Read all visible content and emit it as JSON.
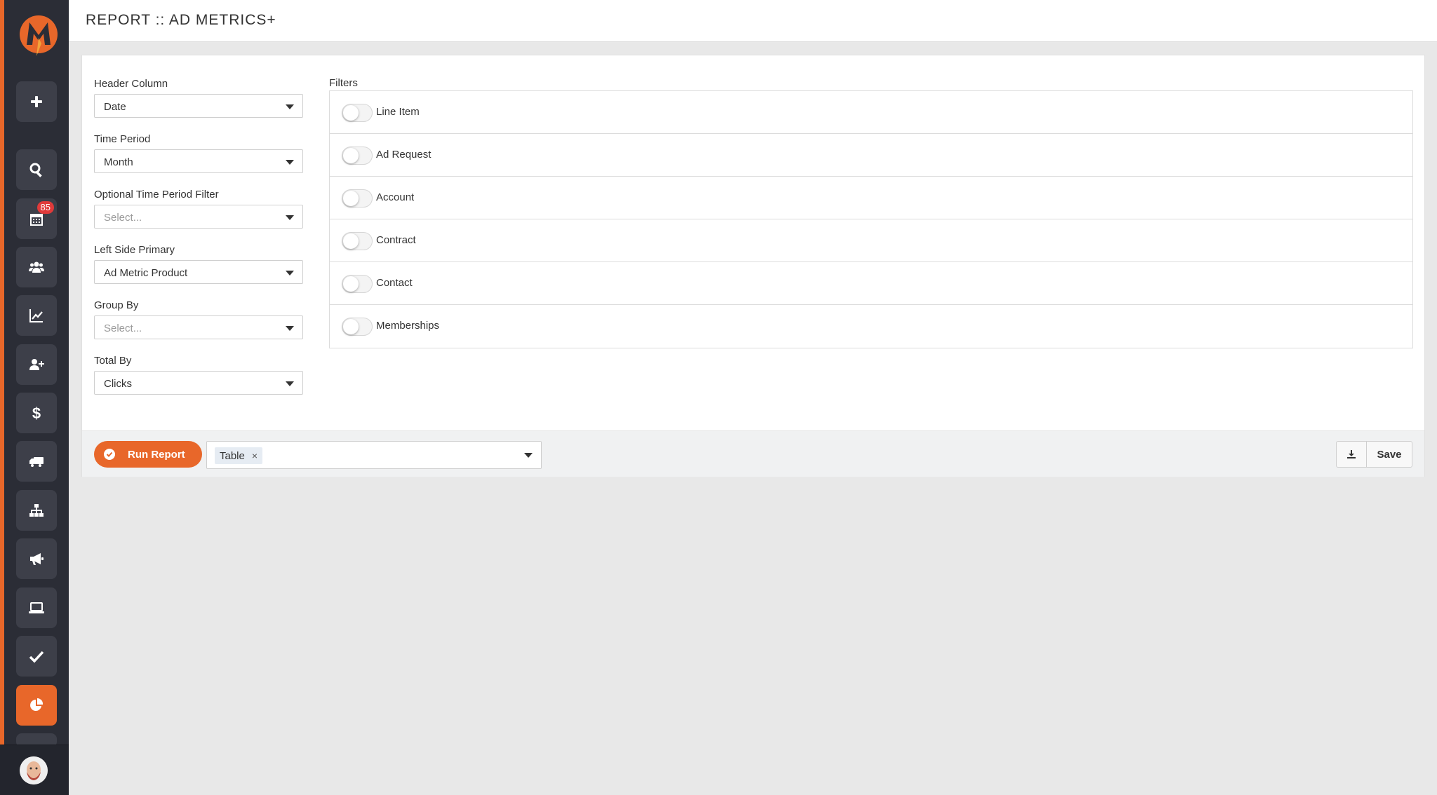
{
  "page": {
    "title": "REPORT :: AD METRICS+"
  },
  "sidebar": {
    "nav": [
      {
        "icon": "plus-icon",
        "name": "add"
      },
      {
        "icon": "search-icon",
        "name": "search"
      },
      {
        "icon": "calendar-icon",
        "name": "calendar",
        "badge": "85"
      },
      {
        "icon": "users-icon",
        "name": "users"
      },
      {
        "icon": "chart-line-icon",
        "name": "analytics"
      },
      {
        "icon": "user-plus-icon",
        "name": "add-user"
      },
      {
        "icon": "dollar-icon",
        "name": "billing"
      },
      {
        "icon": "truck-icon",
        "name": "shipping"
      },
      {
        "icon": "sitemap-icon",
        "name": "hierarchy"
      },
      {
        "icon": "megaphone-icon",
        "name": "campaigns"
      },
      {
        "icon": "laptop-icon",
        "name": "digital"
      },
      {
        "icon": "check-icon",
        "name": "tasks"
      },
      {
        "icon": "pie-chart-icon",
        "name": "reports",
        "active": true
      }
    ],
    "accent": "#e8672a"
  },
  "form": {
    "header_column": {
      "label": "Header Column",
      "value": "Date"
    },
    "time_period": {
      "label": "Time Period",
      "value": "Month"
    },
    "optional_time_period_filter": {
      "label": "Optional Time Period Filter",
      "placeholder": "Select..."
    },
    "left_side_primary": {
      "label": "Left Side Primary",
      "value": "Ad Metric Product"
    },
    "group_by": {
      "label": "Group By",
      "placeholder": "Select..."
    },
    "total_by": {
      "label": "Total By",
      "value": "Clicks"
    }
  },
  "filters": {
    "label": "Filters",
    "items": [
      {
        "label": "Line Item",
        "enabled": false
      },
      {
        "label": "Ad Request",
        "enabled": false
      },
      {
        "label": "Account",
        "enabled": false
      },
      {
        "label": "Contract",
        "enabled": false
      },
      {
        "label": "Contact",
        "enabled": false
      },
      {
        "label": "Memberships",
        "enabled": false
      }
    ]
  },
  "actions": {
    "run_label": "Run Report",
    "output_chip": "Table",
    "chip_remove": "×",
    "save_label": "Save"
  }
}
